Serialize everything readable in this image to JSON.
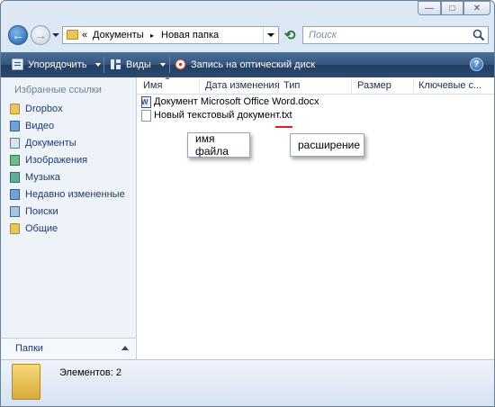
{
  "address": {
    "overflow_glyph": "«",
    "crumbs": [
      "Документы",
      "Новая папка"
    ],
    "separator": "▸"
  },
  "search": {
    "placeholder": "Поиск"
  },
  "window_controls": {
    "minimize": "—",
    "maximize": "□",
    "close": "✕"
  },
  "toolbar": {
    "organize_label": "Упорядочить",
    "views_label": "Виды",
    "burn_label": "Запись на оптический диск",
    "help_label": "?"
  },
  "sidebar": {
    "favorites_title": "Избранные ссылки",
    "items": [
      {
        "label": "Dropbox",
        "icon": "folder-icon"
      },
      {
        "label": "Видео",
        "icon": "video-icon"
      },
      {
        "label": "Документы",
        "icon": "documents-icon"
      },
      {
        "label": "Изображения",
        "icon": "pictures-icon"
      },
      {
        "label": "Музыка",
        "icon": "music-icon"
      },
      {
        "label": "Недавно измененные",
        "icon": "recent-icon"
      },
      {
        "label": "Поиски",
        "icon": "searches-icon"
      },
      {
        "label": "Общие",
        "icon": "public-folder-icon"
      }
    ],
    "folders_label": "Папки"
  },
  "columns": [
    "Имя",
    "Дата изменения",
    "Тип",
    "Размер",
    "Ключевые с..."
  ],
  "files": [
    {
      "name": "Документ Microsoft Office Word.docx",
      "icon": "word-document-icon"
    },
    {
      "name": "Новый текстовый документ.txt",
      "icon": "text-file-icon"
    }
  ],
  "callouts": {
    "filename": "имя файла",
    "extension": "расширение"
  },
  "details": {
    "count_label": "Элементов: 2"
  },
  "colors": {
    "toolbar": "#2a4a72",
    "underline": "#e02020"
  }
}
